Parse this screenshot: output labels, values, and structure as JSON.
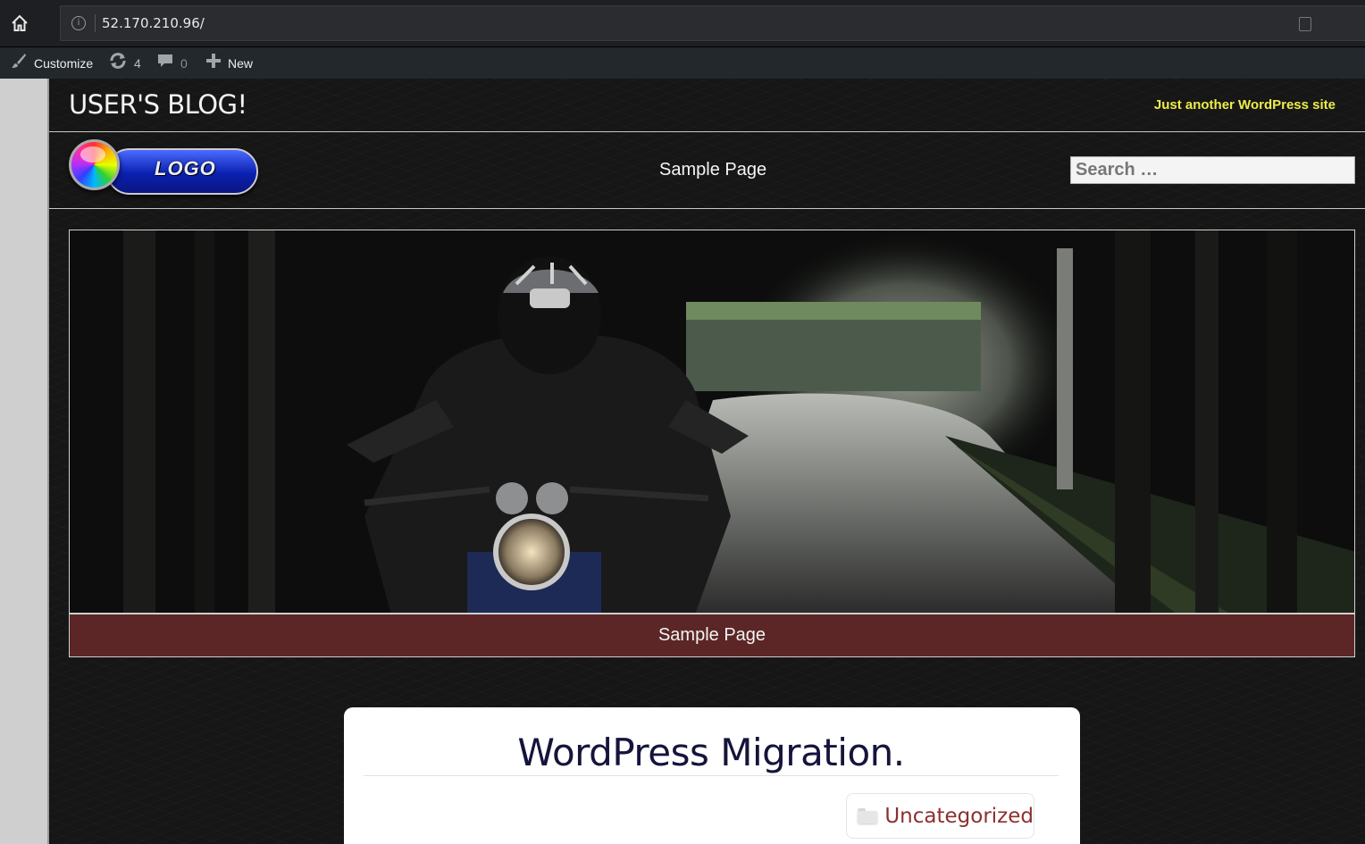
{
  "browser": {
    "url": "52.170.210.96/",
    "home_icon": "home-icon",
    "info_icon": "info-icon"
  },
  "admin_bar": {
    "customize_label": "Customize",
    "updates_count": "4",
    "comments_count": "0",
    "new_label": "New"
  },
  "site": {
    "title": "USER'S BLOG!",
    "tagline": "Just another WordPress site",
    "logo_text": "LOGO",
    "nav": {
      "items": [
        {
          "label": "Sample Page"
        }
      ]
    },
    "search": {
      "placeholder": "Search …"
    },
    "hero_caption": "Sample Page",
    "post": {
      "title": "WordPress Migration.",
      "category": "Uncategorized"
    }
  },
  "colors": {
    "tagline": "#eded4a",
    "caption_bg": "#5c2626",
    "post_title": "#14143c",
    "category": "#8c2f2f",
    "admin_bar_bg": "#23282d"
  }
}
